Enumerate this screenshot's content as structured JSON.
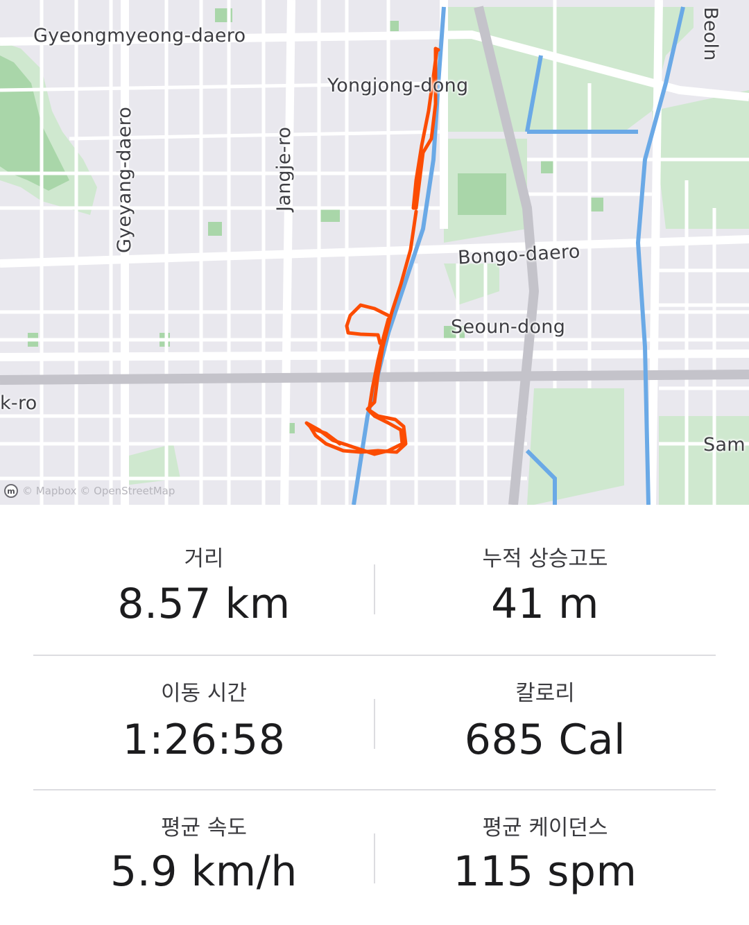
{
  "map": {
    "labels": {
      "gyeongmyeong": "Gyeongmyeong-daero",
      "yongjong": "Yongjong-dong",
      "gyeyang": "Gyeyang-daero",
      "jangje": "Jangje-ro",
      "bongo": "Bongo-daero",
      "seoun": "Seoun-dong",
      "kro": "k-ro",
      "beoln": "Beoln",
      "sam": "Sam"
    },
    "attribution": "© Mapbox © OpenStreetMap",
    "route_color": "#fc4c02"
  },
  "stats": {
    "distance": {
      "label": "거리",
      "value": "8.57 km"
    },
    "elevation_gain": {
      "label": "누적 상승고도",
      "value": "41 m"
    },
    "moving_time": {
      "label": "이동 시간",
      "value": "1:26:58"
    },
    "calories": {
      "label": "칼로리",
      "value": "685 Cal"
    },
    "avg_speed": {
      "label": "평균 속도",
      "value": "5.9 km/h"
    },
    "avg_cadence": {
      "label": "평균 케이던스",
      "value": "115 spm"
    }
  }
}
